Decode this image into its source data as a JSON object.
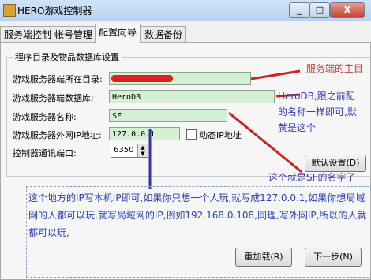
{
  "window": {
    "title": "HERO游戏控制器",
    "minimize": "_",
    "maximize": "□",
    "close": "X"
  },
  "tabs": [
    {
      "label": "服务端控制"
    },
    {
      "label": "帐号管理"
    },
    {
      "label": "配置向导"
    },
    {
      "label": "数据备份"
    }
  ],
  "group": {
    "title": "程序目录及物品数据库设置",
    "fields": {
      "dir_label": "游戏服务器端所在目录:",
      "dir_value": "",
      "db_label": "游戏服务器端数据库:",
      "db_value": "HeroDB",
      "name_label": "游戏服务器名称:",
      "name_value": "SF",
      "ip_label": "游戏服务器外网IP地址:",
      "ip_value": "127.0.0.1",
      "dynamic_ip_label": "动态IP地址",
      "port_label": "控制器通讯端口:",
      "port_value": "6350"
    },
    "default_button": "默认设置(D)"
  },
  "annotations": {
    "dir_note": "服务端的主目",
    "db_note_1": "HeroDB,跟之前配",
    "db_note_2": "的名称一样即可,默",
    "db_note_3": "就是这个",
    "sf_note": "这个就是SF的名字了",
    "ip_note": "这个地方的IP写本机IP即可,如果你只想一个人玩,就写成127.0.0.1,如果你想局域网的人都可以玩,就写局域网的IP,例如192.168.0.108,同理,写外网IP,所以的人就都可以玩,"
  },
  "buttons": {
    "reload": "重加载(R)",
    "next": "下一步(N)"
  },
  "colors": {
    "field_bg": "#d6f0d6",
    "annotation_text": "#3a3ab5",
    "annotation_line_red": "#cc2222",
    "annotation_line_blue": "#3333aa"
  }
}
